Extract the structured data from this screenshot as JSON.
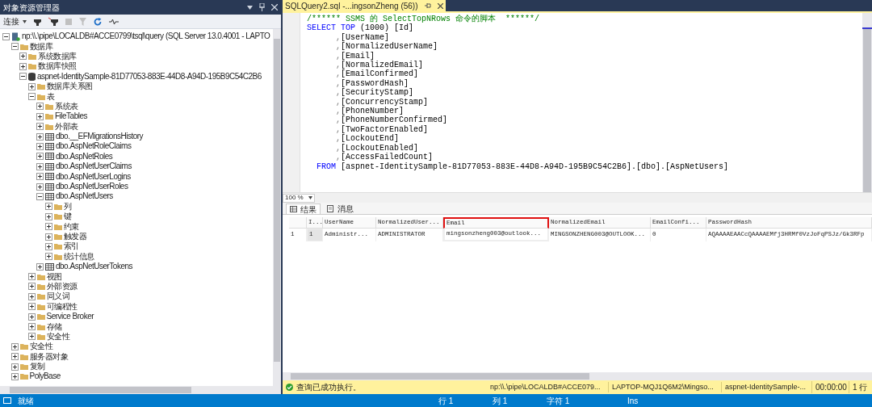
{
  "explorer": {
    "title": "对象资源管理器",
    "connect_label": "连接",
    "tree": [
      {
        "label": "np:\\\\.\\pipe\\LOCALDB#ACCE0799\\tsql\\query (SQL Server 13.0.4001 - LAPTO",
        "kind": "server",
        "expanded": true,
        "children": [
          {
            "label": "数据库",
            "kind": "folder",
            "expanded": true,
            "children": [
              {
                "label": "系统数据库",
                "kind": "folder",
                "expanded": false
              },
              {
                "label": "数据库快照",
                "kind": "folder",
                "expanded": false
              },
              {
                "label": "aspnet-IdentitySample-81D77053-883E-44D8-A94D-195B9C54C2B6",
                "kind": "database",
                "expanded": true,
                "children": [
                  {
                    "label": "数据库关系图",
                    "kind": "folder",
                    "expanded": false
                  },
                  {
                    "label": "表",
                    "kind": "folder",
                    "expanded": true,
                    "children": [
                      {
                        "label": "系统表",
                        "kind": "folder",
                        "expanded": false
                      },
                      {
                        "label": "FileTables",
                        "kind": "folder",
                        "expanded": false
                      },
                      {
                        "label": "外部表",
                        "kind": "folder",
                        "expanded": false
                      },
                      {
                        "label": "dbo.__EFMigrationsHistory",
                        "kind": "table",
                        "expanded": false
                      },
                      {
                        "label": "dbo.AspNetRoleClaims",
                        "kind": "table",
                        "expanded": false
                      },
                      {
                        "label": "dbo.AspNetRoles",
                        "kind": "table",
                        "expanded": false
                      },
                      {
                        "label": "dbo.AspNetUserClaims",
                        "kind": "table",
                        "expanded": false
                      },
                      {
                        "label": "dbo.AspNetUserLogins",
                        "kind": "table",
                        "expanded": false
                      },
                      {
                        "label": "dbo.AspNetUserRoles",
                        "kind": "table",
                        "expanded": false
                      },
                      {
                        "label": "dbo.AspNetUsers",
                        "kind": "table",
                        "expanded": true,
                        "children": [
                          {
                            "label": "列",
                            "kind": "folder",
                            "expanded": false
                          },
                          {
                            "label": "键",
                            "kind": "folder",
                            "expanded": false
                          },
                          {
                            "label": "约束",
                            "kind": "folder",
                            "expanded": false
                          },
                          {
                            "label": "触发器",
                            "kind": "folder",
                            "expanded": false
                          },
                          {
                            "label": "索引",
                            "kind": "folder",
                            "expanded": false
                          },
                          {
                            "label": "统计信息",
                            "kind": "folder",
                            "expanded": false
                          }
                        ]
                      },
                      {
                        "label": "dbo.AspNetUserTokens",
                        "kind": "table",
                        "expanded": false
                      }
                    ]
                  },
                  {
                    "label": "视图",
                    "kind": "folder",
                    "expanded": false
                  },
                  {
                    "label": "外部资源",
                    "kind": "folder",
                    "expanded": false
                  },
                  {
                    "label": "同义词",
                    "kind": "folder",
                    "expanded": false
                  },
                  {
                    "label": "可编程性",
                    "kind": "folder",
                    "expanded": false
                  },
                  {
                    "label": "Service Broker",
                    "kind": "folder",
                    "expanded": false
                  },
                  {
                    "label": "存储",
                    "kind": "folder",
                    "expanded": false
                  },
                  {
                    "label": "安全性",
                    "kind": "folder",
                    "expanded": false
                  }
                ]
              }
            ]
          },
          {
            "label": "安全性",
            "kind": "folder",
            "expanded": false
          },
          {
            "label": "服务器对象",
            "kind": "folder",
            "expanded": false
          },
          {
            "label": "复制",
            "kind": "folder",
            "expanded": false
          },
          {
            "label": "PolyBase",
            "kind": "folder",
            "expanded": false
          }
        ]
      }
    ]
  },
  "editor_tab": {
    "title": "SQLQuery2.sql -...ingsonZheng (56))"
  },
  "editor_lines": [
    [
      {
        "t": "/****** SSMS 的 SelectTopNRows 命令的脚本  ******/",
        "kind": "comment"
      }
    ],
    [
      {
        "t": "SELECT TOP",
        "kind": "keyword"
      },
      {
        "t": " (1000) [Id]",
        "kind": "plain"
      }
    ],
    [
      {
        "t": "      ,",
        "kind": "punct"
      },
      {
        "t": "[UserName]",
        "kind": "plain"
      }
    ],
    [
      {
        "t": "      ,",
        "kind": "punct"
      },
      {
        "t": "[NormalizedUserName]",
        "kind": "plain"
      }
    ],
    [
      {
        "t": "      ,",
        "kind": "punct"
      },
      {
        "t": "[Email]",
        "kind": "plain"
      }
    ],
    [
      {
        "t": "      ,",
        "kind": "punct"
      },
      {
        "t": "[NormalizedEmail]",
        "kind": "plain"
      }
    ],
    [
      {
        "t": "      ,",
        "kind": "punct"
      },
      {
        "t": "[EmailConfirmed]",
        "kind": "plain"
      }
    ],
    [
      {
        "t": "      ,",
        "kind": "punct"
      },
      {
        "t": "[PasswordHash]",
        "kind": "plain"
      }
    ],
    [
      {
        "t": "      ,",
        "kind": "punct"
      },
      {
        "t": "[SecurityStamp]",
        "kind": "plain"
      }
    ],
    [
      {
        "t": "      ,",
        "kind": "punct"
      },
      {
        "t": "[ConcurrencyStamp]",
        "kind": "plain"
      }
    ],
    [
      {
        "t": "      ,",
        "kind": "punct"
      },
      {
        "t": "[PhoneNumber]",
        "kind": "plain"
      }
    ],
    [
      {
        "t": "      ,",
        "kind": "punct"
      },
      {
        "t": "[PhoneNumberConfirmed]",
        "kind": "plain"
      }
    ],
    [
      {
        "t": "      ,",
        "kind": "punct"
      },
      {
        "t": "[TwoFactorEnabled]",
        "kind": "plain"
      }
    ],
    [
      {
        "t": "      ,",
        "kind": "punct"
      },
      {
        "t": "[LockoutEnd]",
        "kind": "plain"
      }
    ],
    [
      {
        "t": "      ,",
        "kind": "punct"
      },
      {
        "t": "[LockoutEnabled]",
        "kind": "plain"
      }
    ],
    [
      {
        "t": "      ,",
        "kind": "punct"
      },
      {
        "t": "[AccessFailedCount]",
        "kind": "plain"
      }
    ],
    [
      {
        "t": "  FROM",
        "kind": "keyword"
      },
      {
        "t": " [aspnet-IdentitySample-81D77053-883E-44D8-A94D-195B9C54C2B6].[dbo].[AspNetUsers]",
        "kind": "plain"
      }
    ]
  ],
  "zoom": "100 %",
  "result_tabs": [
    {
      "label": "结果",
      "selected": true,
      "kind": "grid"
    },
    {
      "label": "消息",
      "selected": false,
      "kind": "messages"
    }
  ],
  "results": {
    "columns": [
      {
        "highlighted": false
      },
      {
        "label": "I...",
        "highlighted": false
      },
      {
        "label": "UserName",
        "highlighted": false
      },
      {
        "label": "NormalizedUser...",
        "highlighted": false
      },
      {
        "label": "Email",
        "highlighted": true
      },
      {
        "label": "NormalizedEmail",
        "highlighted": false
      },
      {
        "label": "EmailConfi...",
        "highlighted": false
      },
      {
        "label": "PasswordHash",
        "highlighted": false
      }
    ],
    "rows": [
      [
        "1",
        "1",
        "Administr...",
        "ADMINISTRATOR",
        "mingsonzheng003@outlook...",
        "MINGSONZHENG003@OUTLOOK...",
        "0",
        "AQAAAAEAACcQAAAAEMfj3HRMf0VzJoFqPSJz/Gk3RFp"
      ]
    ]
  },
  "query_status": {
    "message": "查询已成功执行。",
    "server": "np:\\\\.\\pipe\\LOCALDB#ACCE079...",
    "user": "LAPTOP-MQJ1Q6M2\\Mingso...",
    "database": "aspnet-IdentitySample-...",
    "time": "00:00:00",
    "rows": "1 行"
  },
  "status_bar": {
    "state": "就绪",
    "line": "行 1",
    "column": "列 1",
    "char": "字符 1",
    "mode": "Ins"
  }
}
